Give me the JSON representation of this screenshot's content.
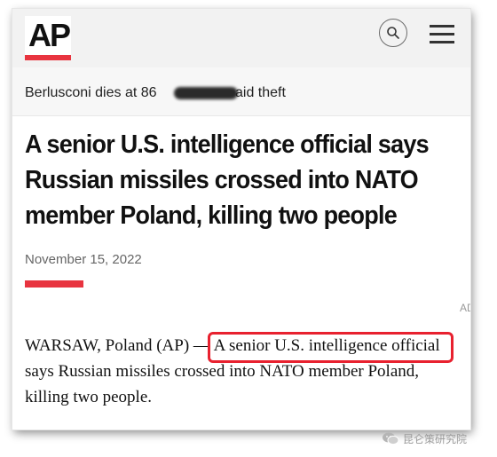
{
  "header": {
    "logo_text": "AP",
    "brand_color": "#e8343f",
    "search_icon": "search-icon",
    "menu_icon": "hamburger-menu-icon"
  },
  "ticker": {
    "items": [
      "Berlusconi dies at 86",
      "aid theft"
    ]
  },
  "article": {
    "headline": "A senior U.S. intelligence official says Russian missiles crossed into NATO member Poland, killing two people",
    "date": "November 15, 2022",
    "ad_label": "AD",
    "body_prefix": "WARSAW, Poland (AP) — ",
    "body_highlight": "A senior U.S. intelligence official",
    "body_rest": " says Russian missiles crossed into NATO member Poland, killing two people.",
    "highlight_color": "#e8212f"
  },
  "watermark": {
    "text": "昆仑策研究院"
  }
}
